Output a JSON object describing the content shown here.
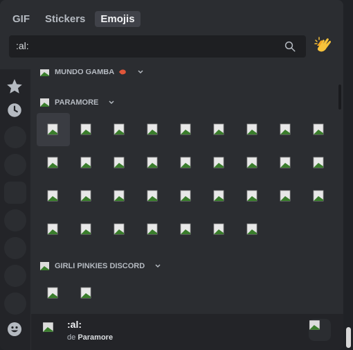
{
  "tabs": [
    "GIF",
    "Stickers",
    "Emojis"
  ],
  "active_tab": "Emojis",
  "search": {
    "value": ":al:",
    "icon": "search-icon"
  },
  "skin_tone_button": {
    "icon": "clapping-hands-icon"
  },
  "rail": {
    "items": [
      "star-icon",
      "clock-icon",
      "server-emoji-icon",
      "server-emoji-icon",
      "server-emoji-icon",
      "server-emoji-icon",
      "server-emoji-icon",
      "server-emoji-icon",
      "server-emoji-icon",
      "smiley-icon"
    ]
  },
  "categories": [
    {
      "name": "MUNDO GAMBA",
      "suffix_icon": "shrimp-icon"
    },
    {
      "name": "PARAMORE"
    },
    {
      "name": "GIRLI PINKIES DISCORD"
    }
  ],
  "paramore_emoji_count": 34,
  "girli_emoji_count": 2,
  "footer": {
    "name": ":al:",
    "source_prefix": "de",
    "source_name": "Paramore"
  },
  "colors": {
    "panel_bg": "#2b2d31",
    "rail_bg": "#232428",
    "search_bg": "#1e1f22",
    "active_tab_bg": "#404249"
  }
}
